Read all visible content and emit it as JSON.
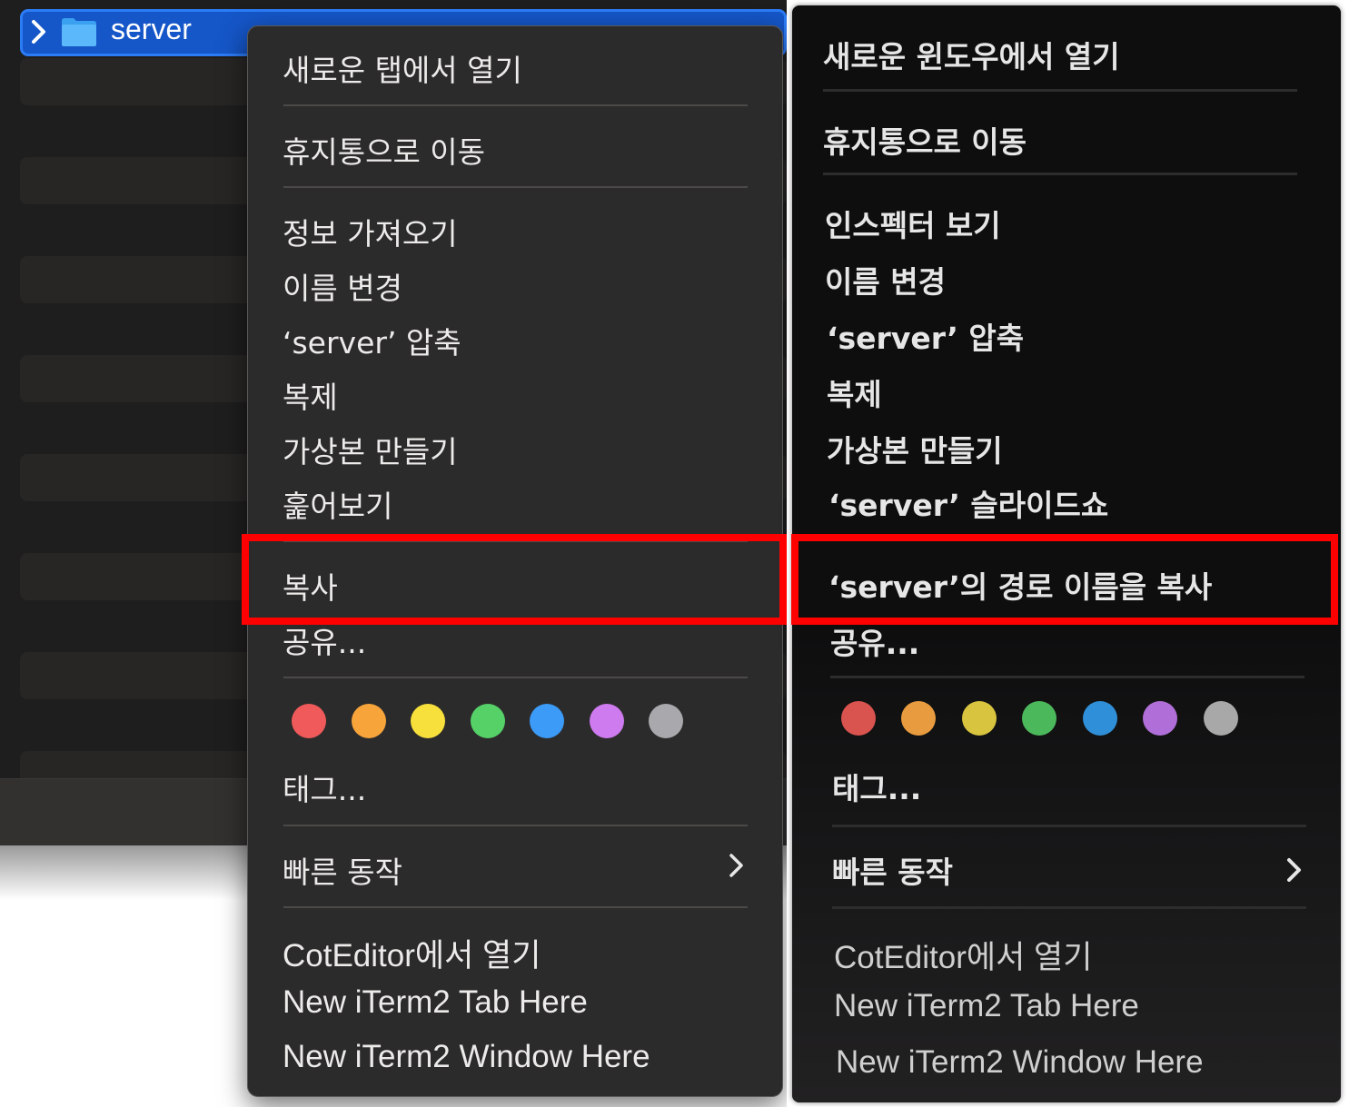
{
  "finder": {
    "folder_name": "server",
    "folder_icon": "folder-icon",
    "disclosure_icon": "chevron-right-icon"
  },
  "menu_left": {
    "items": [
      "새로운 탭에서 열기",
      "휴지통으로 이동",
      "정보 가져오기",
      "이름 변경",
      "‘server’ 압축",
      "복제",
      "가상본 만들기",
      "훑어보기",
      "복사",
      "공유...",
      "태그...",
      "빠른 동작",
      "CotEditor에서 열기",
      "New iTerm2 Tab Here",
      "New iTerm2 Window Here"
    ],
    "highlighted_item": "복사",
    "submenu_icon": "chevron-right-icon"
  },
  "menu_right": {
    "items": [
      "새로운 윈도우에서 열기",
      "휴지통으로 이동",
      "인스펙터 보기",
      "이름 변경",
      "‘server’ 압축",
      "복제",
      "가상본 만들기",
      "‘server’ 슬라이드쇼",
      "‘server’의 경로 이름을 복사",
      "공유...",
      "태그...",
      "빠른 동작",
      "CotEditor에서 열기",
      "New iTerm2 Tab Here",
      "New iTerm2 Window Here"
    ],
    "highlighted_item": "‘server’의 경로 이름을 복사",
    "submenu_icon": "chevron-right-icon"
  },
  "tag_colors": [
    "#f05a5a",
    "#f7a43b",
    "#f7e03b",
    "#55d168",
    "#3b9bf7",
    "#cf7bf0",
    "#a9a9ad"
  ],
  "tag_colors_right": [
    "#d9534f",
    "#e89b3f",
    "#d8c43f",
    "#4cb85c",
    "#2f8fd8",
    "#b06fd8",
    "#a8a8a8"
  ],
  "highlight_color": "#ff0000"
}
